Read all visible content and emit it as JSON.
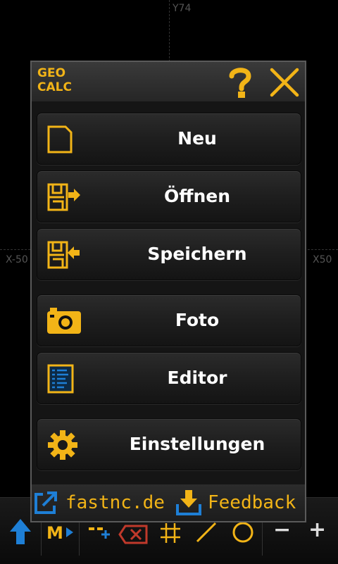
{
  "canvas": {
    "y_axis_label": "Y74",
    "x_neg_label": "X-50",
    "x_pos_label": "X50"
  },
  "toolbar": {
    "minus_label": "−",
    "plus_label": "+"
  },
  "dialog": {
    "logo_line1": "GEO",
    "logo_line2": "CALC",
    "items": [
      {
        "label": "Neu",
        "icon": "new-document-icon"
      },
      {
        "label": "Öffnen",
        "icon": "open-file-icon"
      },
      {
        "label": "Speichern",
        "icon": "save-file-icon"
      },
      {
        "label": "Foto",
        "icon": "camera-icon"
      },
      {
        "label": "Editor",
        "icon": "editor-icon"
      },
      {
        "label": "Einstellungen",
        "icon": "gear-icon"
      }
    ],
    "footer": {
      "website": "fastnc.de",
      "feedback": "Feedback"
    }
  },
  "colors": {
    "accent": "#f2b417",
    "link_blue": "#1e7fd6",
    "delete_red": "#c0392b"
  }
}
